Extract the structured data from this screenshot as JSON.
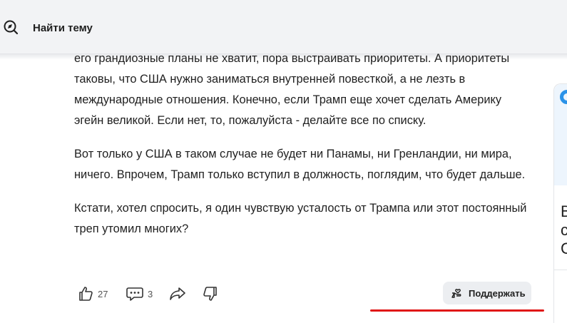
{
  "search": {
    "label": "Найти тему",
    "icon": "compass-search-icon"
  },
  "article": {
    "paragraphs": [
      "его грандиозные планы не хватит, пора выстраивать приоритеты. А приоритеты таковы, что США нужно заниматься внутренней повесткой, а не лезть в международные отношения. Конечно, если Трамп еще хочет сделать Америку эгейн великой. Если нет, то, пожалуйста - делайте все по списку.",
      "Вот только у США в таком случае не будет ни Панамы, ни Гренландии, ни мира, ничего. Впрочем, Трамп только вступил в должность, поглядим, что будет дальше.",
      "Кстати, хотел спросить, я один чувствую усталость от Трампа или этот постоянный треп утомил многих?"
    ]
  },
  "actions": {
    "likes": "27",
    "comments": "3",
    "support_label": "Поддержать"
  },
  "side": {
    "letters": [
      "В",
      "с",
      "С"
    ]
  },
  "colors": {
    "accent_red": "#e01515",
    "side_blue": "#2a92e8"
  }
}
